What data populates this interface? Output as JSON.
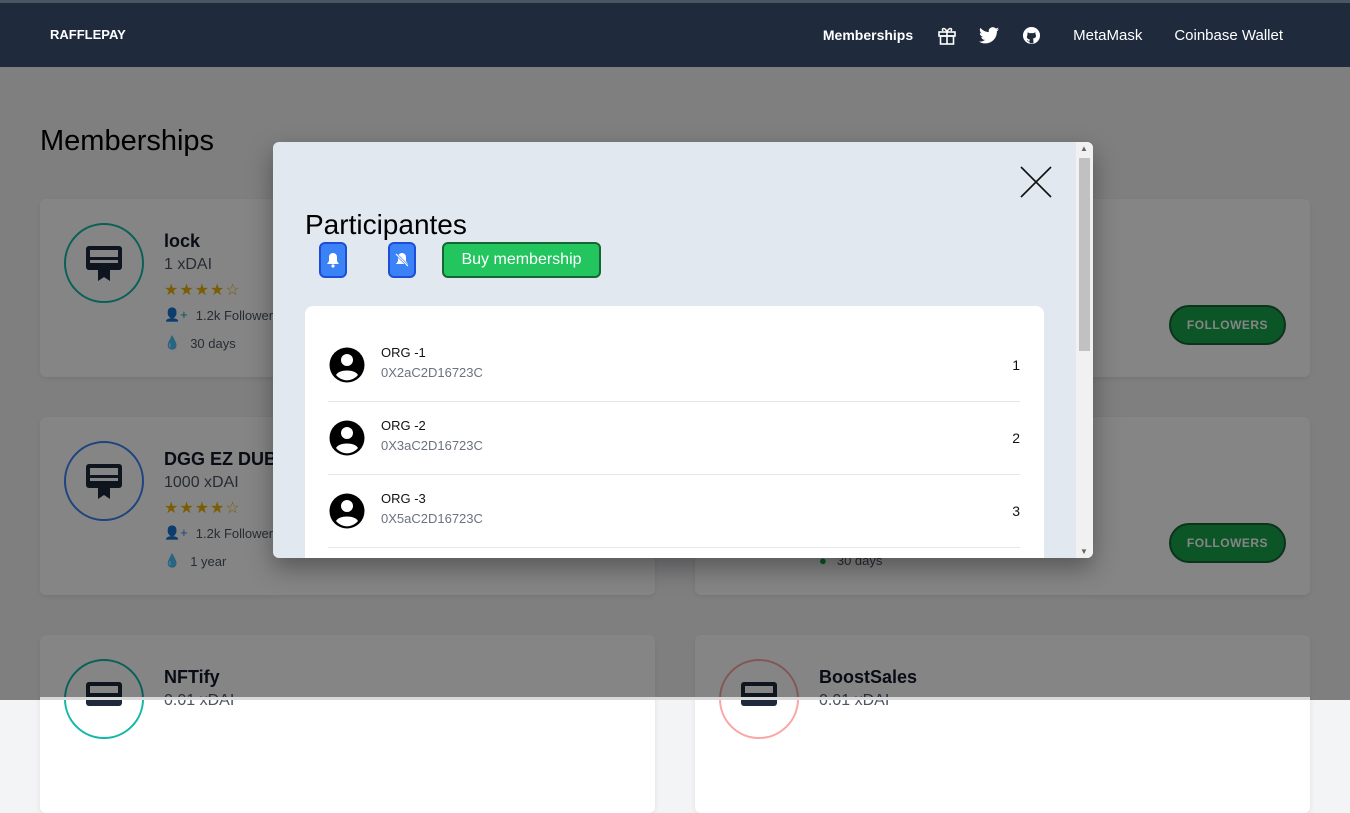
{
  "nav": {
    "brand": "RAFFLEPAY",
    "memberships": "Memberships",
    "icons": [
      "gift-icon",
      "twitter-icon",
      "github-icon"
    ],
    "metamask": "MetaMask",
    "coinbase": "Coinbase Wallet"
  },
  "page": {
    "title": "Memberships"
  },
  "cards": [
    {
      "title": "lock",
      "price": "1 xDAI",
      "stars": "★★★★☆",
      "rating": 4,
      "followers": "1.2k Followers",
      "duration": "30 days",
      "ring": "#14b8a6"
    },
    {
      "title": "DGG EZ DUBS",
      "price": "1000 xDAI",
      "stars": "★★★★☆",
      "rating": 4,
      "followers": "1.2k Followers",
      "duration": "1 year",
      "ring": "#3b82f6"
    },
    {
      "duration": "30 days",
      "button": "FOLLOWERS"
    },
    {
      "button": "FOLLOWERS"
    },
    {
      "title": "NFTify",
      "price": "0.01 xDAI",
      "ring": "#14b8a6"
    },
    {
      "title": "BoostSales",
      "price": "0.01 xDAI",
      "ring": "#fca5a5"
    }
  ],
  "modal": {
    "title": "Participantes",
    "buy": "Buy membership",
    "participants": [
      {
        "name": "ORG -1",
        "address": "0X2aC2D16723C",
        "rank": "1"
      },
      {
        "name": "ORG -2",
        "address": "0X3aC2D16723C",
        "rank": "2"
      },
      {
        "name": "ORG -3",
        "address": "0X5aC2D16723C",
        "rank": "3"
      }
    ]
  }
}
